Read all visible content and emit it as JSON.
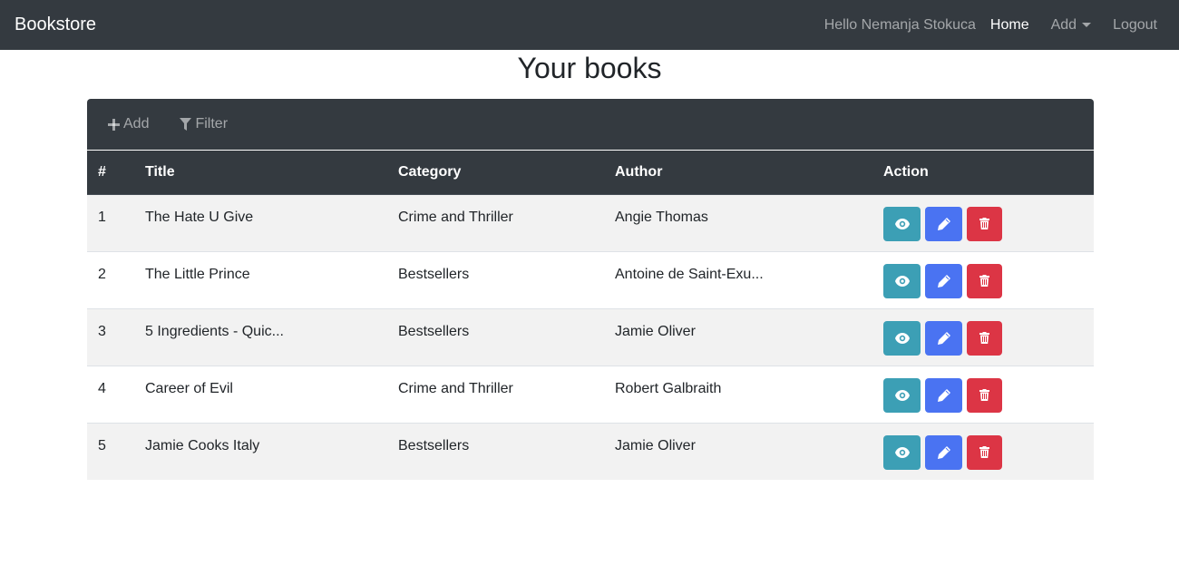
{
  "navbar": {
    "brand": "Bookstore",
    "greeting": "Hello Nemanja Stokuca",
    "links": {
      "home": "Home",
      "add": "Add",
      "logout": "Logout"
    }
  },
  "page": {
    "title": "Your books"
  },
  "toolbar": {
    "add_label": "Add",
    "filter_label": "Filter"
  },
  "table": {
    "headers": [
      "#",
      "Title",
      "Category",
      "Author",
      "Action"
    ],
    "rows": [
      {
        "num": "1",
        "title": "The Hate U Give",
        "category": "Crime and Thriller",
        "author": "Angie Thomas"
      },
      {
        "num": "2",
        "title": "The Little Prince",
        "category": "Bestsellers",
        "author": "Antoine de Saint-Exu..."
      },
      {
        "num": "3",
        "title": "5 Ingredients - Quic...",
        "category": "Bestsellers",
        "author": "Jamie Oliver"
      },
      {
        "num": "4",
        "title": "Career of Evil",
        "category": "Crime and Thriller",
        "author": "Robert Galbraith"
      },
      {
        "num": "5",
        "title": "Jamie Cooks Italy",
        "category": "Bestsellers",
        "author": "Jamie Oliver"
      }
    ]
  },
  "icons": {
    "add": "plus-icon",
    "filter": "filter-icon",
    "view": "eye-icon",
    "edit": "pencil-icon",
    "delete": "trash-icon",
    "dropdown": "caret-down-icon"
  },
  "colors": {
    "navbar_bg": "#343a40",
    "view_button": "#3c9fb5",
    "edit_button": "#4a73f2",
    "delete_button": "#dc3545",
    "striped_row": "#f2f2f2"
  }
}
